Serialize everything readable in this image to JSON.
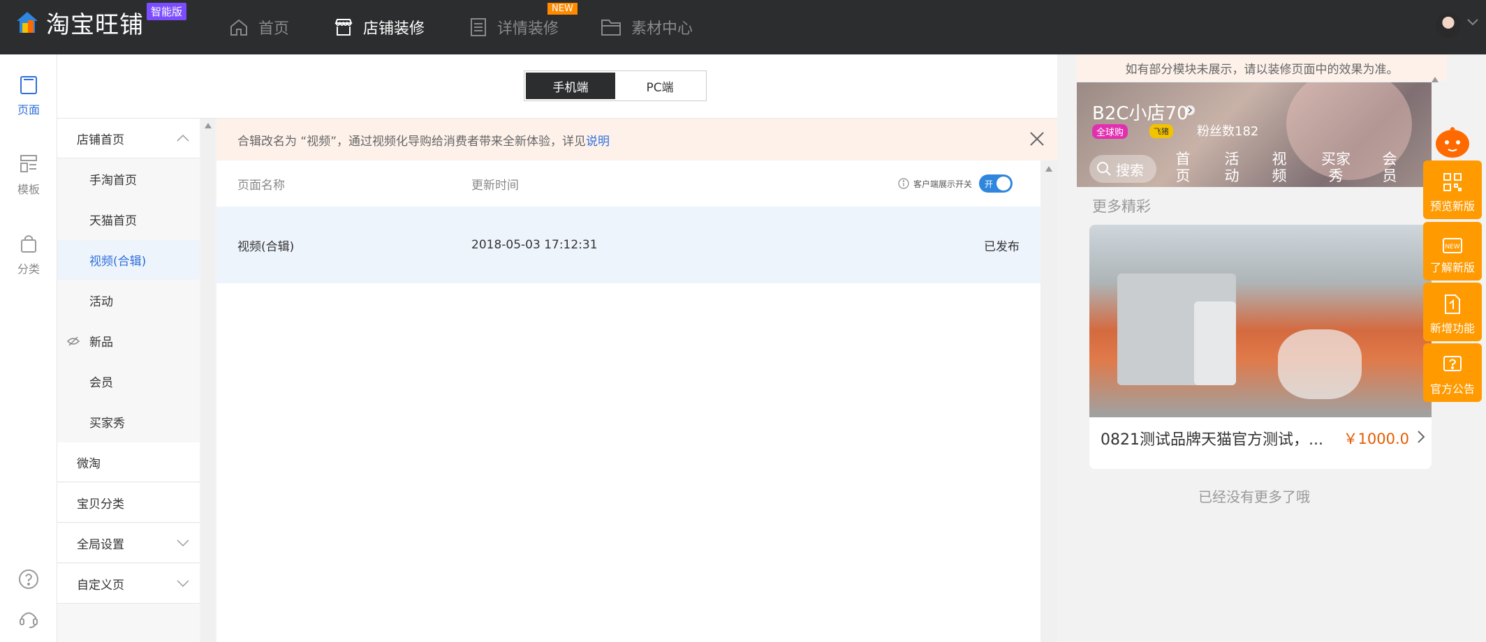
{
  "app": {
    "logo_text": "淘宝旺铺",
    "edition_badge": "智能版"
  },
  "nav": {
    "items": [
      {
        "label": "首页"
      },
      {
        "label": "店铺装修"
      },
      {
        "label": "详情装修"
      },
      {
        "label": "素材中心"
      }
    ],
    "new_tag": "NEW"
  },
  "rail": {
    "items": [
      {
        "label": "页面"
      },
      {
        "label": "模板"
      },
      {
        "label": "分类"
      }
    ]
  },
  "device_toggle": {
    "mobile": "手机端",
    "pc": "PC端"
  },
  "tree": {
    "shop_home": "店铺首页",
    "children": [
      "手淘首页",
      "天猫首页",
      "视频(合辑)",
      "活动",
      "新品",
      "会员",
      "买家秀"
    ],
    "others": [
      "微淘",
      "宝贝分类",
      "全局设置",
      "自定义页"
    ]
  },
  "notice": {
    "text": "合辑改名为 “视频”，通过视频化导购给消费者带来全新体验，详见",
    "link": "说明"
  },
  "table": {
    "col_name": "页面名称",
    "col_time": "更新时间",
    "switch_label": "客户端展示开关",
    "switch_state": "开",
    "rows": [
      {
        "name": "视频(合辑)",
        "time": "2018-05-03 17:12:31",
        "status": "已发布"
      }
    ]
  },
  "preview": {
    "tip": "如有部分模块未展示，请以装修页面中的效果为准。",
    "shop_name": "B2C小店70",
    "badge_global": "全球购",
    "badge_level": "飞猪",
    "fans": "粉丝数182",
    "search": "搜索",
    "tabs": [
      "首页",
      "活动",
      "视频",
      "买家秀",
      "会员"
    ],
    "more_title": "更多精彩",
    "card_title": "0821测试品牌天猫官方测试，...",
    "card_price": "￥1000.0",
    "no_more": "已经没有更多了哦"
  },
  "side_buttons": [
    "预览新版",
    "了解新版",
    "新增功能",
    "官方公告"
  ],
  "colors": {
    "topbar": "#2b2d2e",
    "accent_blue": "#2e6fdc",
    "orange": "#ff9a00",
    "price": "#e45c00"
  }
}
